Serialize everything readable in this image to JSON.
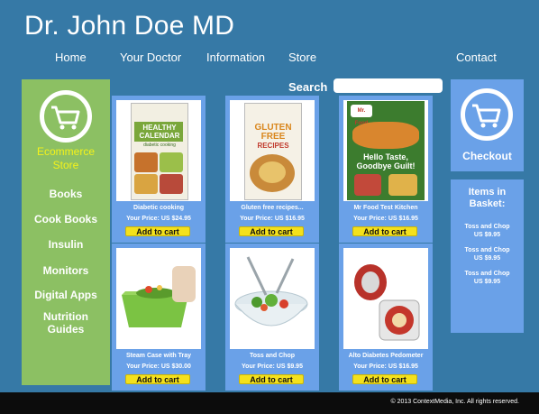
{
  "site_title": "Dr. John Doe MD",
  "nav": [
    "Home",
    "Your Doctor",
    "Information",
    "Store",
    "Contact"
  ],
  "search": {
    "label": "Search",
    "placeholder": ""
  },
  "sidebar": {
    "store_label_1": "Ecommerce",
    "store_label_2": "Store",
    "categories": [
      "Books",
      "Cook Books",
      "Insulin",
      "Monitors",
      "Digital Apps",
      "Nutrition",
      "Guides"
    ]
  },
  "checkout": {
    "label": "Checkout"
  },
  "basket": {
    "title_1": "Items in",
    "title_2": "Basket:",
    "items": [
      {
        "name": "Toss and Chop",
        "price": "US $9.95"
      },
      {
        "name": "Toss and Chop",
        "price": "US $9.95"
      },
      {
        "name": "Toss and Chop",
        "price": "US $9.95"
      }
    ]
  },
  "products": [
    {
      "name": "Diabetic cooking",
      "price": "Your Price: US $24.95",
      "button": "Add to cart",
      "cover_lines": [
        "HEALTHY",
        "CALENDAR",
        "diabetic cooking"
      ]
    },
    {
      "name": "Gluten free recipes...",
      "price": "Your Price: US $16.95",
      "button": "Add to cart",
      "cover_lines": [
        "GLUTEN",
        "FREE",
        "RECIPES"
      ]
    },
    {
      "name": "Mr Food Test Kitchen",
      "price": "Your Price: US $16.95",
      "button": "Add to cart",
      "cover_lines": [
        "Mr. Food",
        "Hello Taste,",
        "Goodbye Guilt!"
      ]
    },
    {
      "name": "Steam Case with Tray",
      "price": "Your Price: US $30.00",
      "button": "Add to cart"
    },
    {
      "name": "Toss and Chop",
      "price": "Your Price: US $9.95",
      "button": "Add to cart"
    },
    {
      "name": "Alto Diabetes Pedometer",
      "price": "Your Price: US $16.95",
      "button": "Add to cart"
    }
  ],
  "footer": "© 2013 ContextMedia, Inc. All rights reserved.",
  "colors": {
    "background": "#3679a6",
    "sidebar": "#8cc063",
    "panel": "#6aa1e8",
    "accent_text": "#f4f21a",
    "button": "#f4e11c",
    "footer": "#0c0c0c"
  },
  "icons": [
    "shopping-cart-icon",
    "shopping-cart-icon"
  ]
}
